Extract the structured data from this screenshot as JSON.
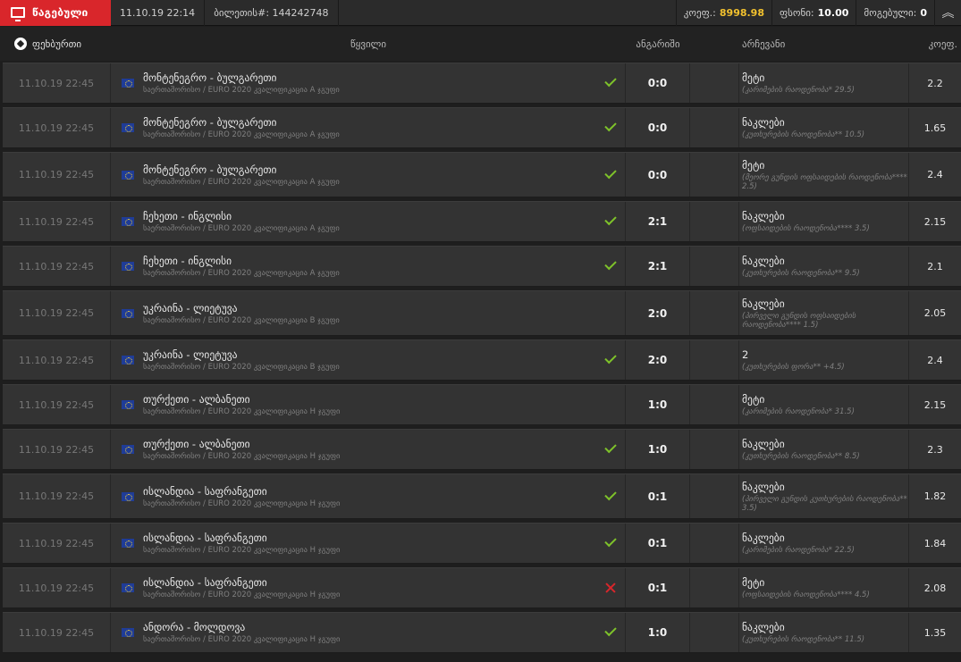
{
  "topbar": {
    "status_label": "წაგებული",
    "datetime": "11.10.19 22:14",
    "ticket_label": "ბილეთის#: 144242748",
    "coef_label": "კოეფ.:",
    "coef_value": "8998.98",
    "stake_label": "ფსონი:",
    "stake_value": "10.00",
    "win_label": "მოგებული:",
    "win_value": "0"
  },
  "header": {
    "sport": "ფეხბურთი",
    "event": "წყვილი",
    "score": "ანგარიში",
    "choice": "არჩევანი",
    "odds": "კოეფ."
  },
  "rows": [
    {
      "date": "11.10.19 22:45",
      "event": "მონტენეგრო - ბულგარეთი",
      "league": "საერთაშორისო / EURO 2020 კვალიფიკაცია A ჯგუფი",
      "status": "ok",
      "score": "0:0",
      "choice": "მეტი",
      "choice_sub": "(კარიმების რაოდენობა* 29.5)",
      "odds": "2.2"
    },
    {
      "date": "11.10.19 22:45",
      "event": "მონტენეგრო - ბულგარეთი",
      "league": "საერთაშორისო / EURO 2020 კვალიფიკაცია A ჯგუფი",
      "status": "ok",
      "score": "0:0",
      "choice": "ნაკლები",
      "choice_sub": "(კუთხურების რაოდენობა** 10.5)",
      "odds": "1.65"
    },
    {
      "date": "11.10.19 22:45",
      "event": "მონტენეგრო - ბულგარეთი",
      "league": "საერთაშორისო / EURO 2020 კვალიფიკაცია A ჯგუფი",
      "status": "ok",
      "score": "0:0",
      "choice": "მეტი",
      "choice_sub": "(მეორე გუნდის ოფსაიდების რაოდენობა**** 2.5)",
      "odds": "2.4"
    },
    {
      "date": "11.10.19 22:45",
      "event": "ჩეხეთი - ინგლისი",
      "league": "საერთაშორისო / EURO 2020 კვალიფიკაცია A ჯგუფი",
      "status": "ok",
      "score": "2:1",
      "choice": "ნაკლები",
      "choice_sub": "(ოფსაიდების რაოდენობა**** 3.5)",
      "odds": "2.15"
    },
    {
      "date": "11.10.19 22:45",
      "event": "ჩეხეთი - ინგლისი",
      "league": "საერთაშორისო / EURO 2020 კვალიფიკაცია A ჯგუფი",
      "status": "ok",
      "score": "2:1",
      "choice": "ნაკლები",
      "choice_sub": "(კუთხურების რაოდენობა** 9.5)",
      "odds": "2.1"
    },
    {
      "date": "11.10.19 22:45",
      "event": "უკრაინა - ლიეტუვა",
      "league": "საერთაშორისო / EURO 2020 კვალიფიკაცია B ჯგუფი",
      "status": "none",
      "score": "2:0",
      "choice": "ნაკლები",
      "choice_sub": "(პირველი გუნდის ოფსაიდების რაოდენობა**** 1.5)",
      "odds": "2.05"
    },
    {
      "date": "11.10.19 22:45",
      "event": "უკრაინა - ლიეტუვა",
      "league": "საერთაშორისო / EURO 2020 კვალიფიკაცია B ჯგუფი",
      "status": "ok",
      "score": "2:0",
      "choice": "2",
      "choice_sub": "(კუთხურების ფორა** +4.5)",
      "odds": "2.4"
    },
    {
      "date": "11.10.19 22:45",
      "event": "თურქეთი - ალბანეთი",
      "league": "საერთაშორისო / EURO 2020 კვალიფიკაცია H ჯგუფი",
      "status": "none",
      "score": "1:0",
      "choice": "მეტი",
      "choice_sub": "(კარიმების რაოდენობა* 31.5)",
      "odds": "2.15"
    },
    {
      "date": "11.10.19 22:45",
      "event": "თურქეთი - ალბანეთი",
      "league": "საერთაშორისო / EURO 2020 კვალიფიკაცია H ჯგუფი",
      "status": "ok",
      "score": "1:0",
      "choice": "ნაკლები",
      "choice_sub": "(კუთხურების რაოდენობა** 8.5)",
      "odds": "2.3"
    },
    {
      "date": "11.10.19 22:45",
      "event": "ისლანდია - საფრანგეთი",
      "league": "საერთაშორისო / EURO 2020 კვალიფიკაცია H ჯგუფი",
      "status": "ok",
      "score": "0:1",
      "choice": "ნაკლები",
      "choice_sub": "(პირველი გუნდის კუთხურების რაოდენობა** 3.5)",
      "odds": "1.82"
    },
    {
      "date": "11.10.19 22:45",
      "event": "ისლანდია - საფრანგეთი",
      "league": "საერთაშორისო / EURO 2020 კვალიფიკაცია H ჯგუფი",
      "status": "ok",
      "score": "0:1",
      "choice": "ნაკლები",
      "choice_sub": "(კარიმების რაოდენობა* 22.5)",
      "odds": "1.84"
    },
    {
      "date": "11.10.19 22:45",
      "event": "ისლანდია - საფრანგეთი",
      "league": "საერთაშორისო / EURO 2020 კვალიფიკაცია H ჯგუფი",
      "status": "lose",
      "score": "0:1",
      "choice": "მეტი",
      "choice_sub": "(ოფსაიდების რაოდენობა**** 4.5)",
      "odds": "2.08"
    },
    {
      "date": "11.10.19 22:45",
      "event": "ანდორა - მოლდოვა",
      "league": "საერთაშორისო / EURO 2020 კვალიფიკაცია H ჯგუფი",
      "status": "ok",
      "score": "1:0",
      "choice": "ნაკლები",
      "choice_sub": "(კუთხურების რაოდენობა** 11.5)",
      "odds": "1.35"
    }
  ]
}
